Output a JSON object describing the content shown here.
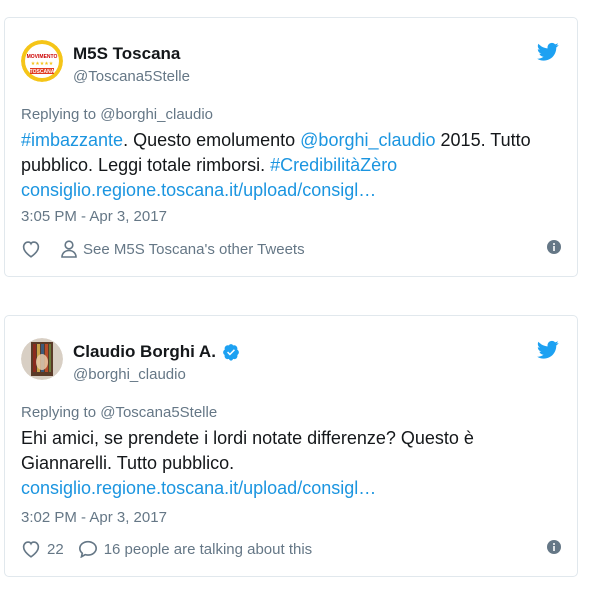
{
  "tweets": [
    {
      "display_name": "M5S Toscana",
      "handle": "@Toscana5Stelle",
      "replying_prefix": "Replying to",
      "replying_to": "@borghi_claudio",
      "text": {
        "hashtag1": "#imbazzante",
        "t1": ". Questo emolumento ",
        "mention": "@borghi_claudio",
        "t2": " 2015. Tutto pubblico. Leggi totale rimborsi. ",
        "hashtag2": "#CredibilitàZèro",
        "link": "consiglio.regione.toscana.it/upload/consigl…"
      },
      "timestamp": "3:05 PM - Apr 3, 2017",
      "like_count": "",
      "profile_link": "See M5S Toscana's other Tweets",
      "avatar_text": "TOSCANA",
      "avatar_brand": "MOVIMENTO"
    },
    {
      "display_name": "Claudio Borghi A.",
      "handle": "@borghi_claudio",
      "replying_prefix": "Replying to",
      "replying_to": "@Toscana5Stelle",
      "text": {
        "body": "Ehi amici, se prendete i lordi notate differenze? Questo è Giannarelli. Tutto pubblico.",
        "link": "consiglio.regione.toscana.it/upload/consigl…"
      },
      "timestamp": "3:02 PM - Apr 3, 2017",
      "like_count": "22",
      "conversation": "16 people are talking about this"
    }
  ],
  "colors": {
    "brand_blue": "#1da1f2",
    "link_blue": "#1b95e0",
    "muted_gray": "#657786",
    "text_dark": "#14171a",
    "border": "#e1e8ed"
  },
  "icons": [
    "twitter-bird-icon",
    "heart-icon",
    "person-icon",
    "info-icon",
    "verified-badge-icon",
    "speech-bubble-icon"
  ]
}
